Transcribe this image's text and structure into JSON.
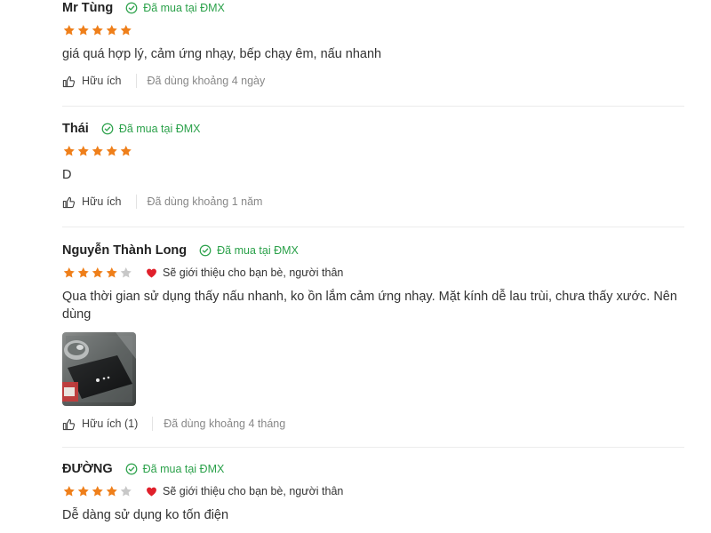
{
  "colors": {
    "star": "#ef7f1a",
    "star_empty": "#c8c8c8",
    "verified": "#2ba14a",
    "heart": "#e0202b"
  },
  "reviews": [
    {
      "name": "Mr Tùng",
      "verified": "Đã mua tại ĐMX",
      "rating": 5,
      "recommend": "",
      "text": "giá quá hợp lý, cảm ứng nhạy, bếp chạy êm, nấu nhanh",
      "has_photo": false,
      "helpful": "Hữu ích",
      "used": "Đã dùng khoảng 4 ngày"
    },
    {
      "name": "Thái",
      "verified": "Đã mua tại ĐMX",
      "rating": 5,
      "recommend": "",
      "text": "D",
      "has_photo": false,
      "helpful": "Hữu ích",
      "used": "Đã dùng khoảng 1 năm"
    },
    {
      "name": "Nguyễn Thành Long",
      "verified": "Đã mua tại ĐMX",
      "rating": 4,
      "recommend": "Sẽ giới thiệu cho bạn bè, người thân",
      "text": "Qua thời gian sử dụng thấy nấu nhanh, ko ồn lắm cảm ứng nhạy. Mặt kính dễ lau trùi, chưa thấy xước. Nên dùng",
      "has_photo": true,
      "helpful": "Hữu ích (1)",
      "used": "Đã dùng khoảng 4 tháng"
    },
    {
      "name": "ĐƯỜNG",
      "verified": "Đã mua tại ĐMX",
      "rating": 4,
      "recommend": "Sẽ giới thiệu cho bạn bè, người thân",
      "text": "Dễ dàng sử dụng ko tốn điện",
      "has_photo": false,
      "helpful": "",
      "used": ""
    }
  ]
}
